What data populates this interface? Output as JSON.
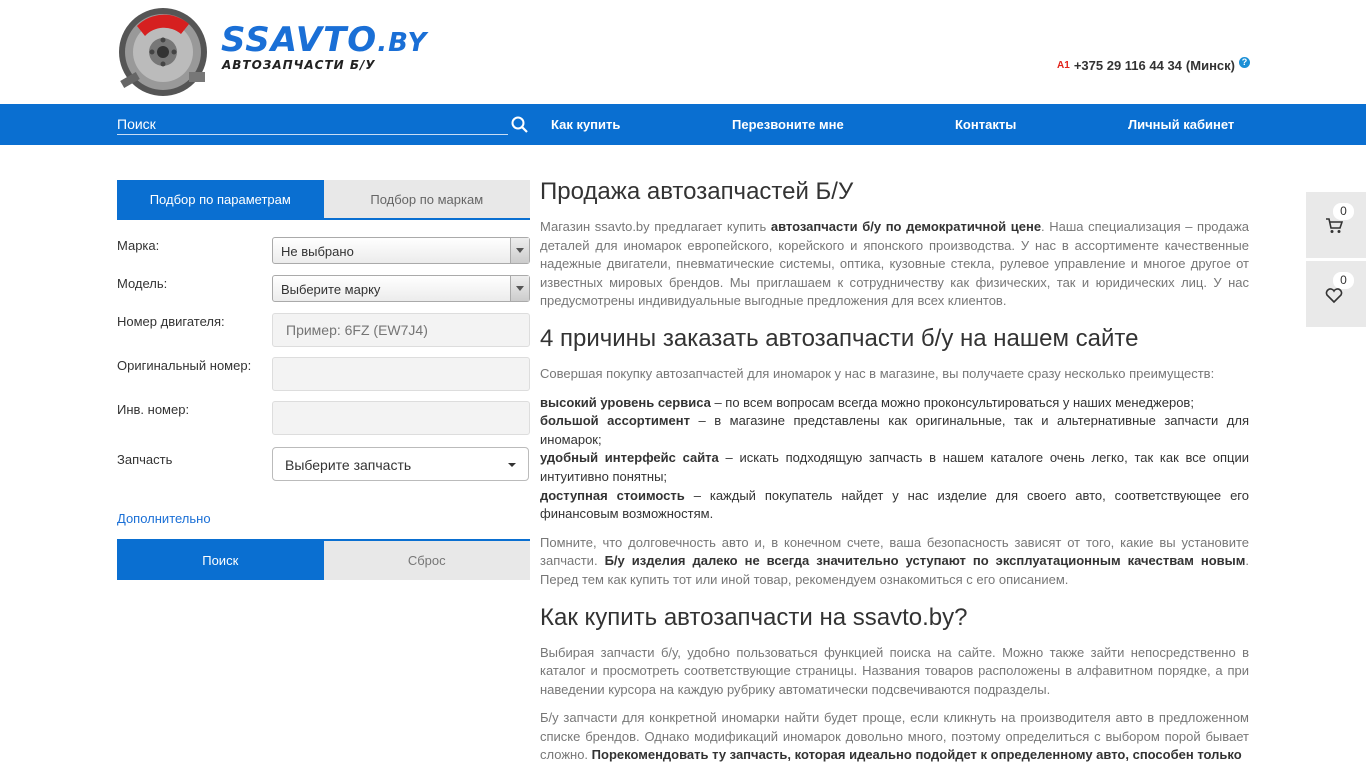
{
  "header": {
    "logo_main": "SSAVTO",
    "logo_domain": ".BY",
    "logo_sub": "АВТОЗАПЧАСТИ Б/У",
    "operator": "A1",
    "phone": "+375 29 116 44 34",
    "city": "(Минск)",
    "help": "?"
  },
  "nav": {
    "search_placeholder": "Поиск",
    "links": [
      "Как купить",
      "Перезвоните мне",
      "Контакты",
      "Личный кабинет"
    ]
  },
  "filter": {
    "tabs": [
      "Подбор по параметрам",
      "Подбор по маркам"
    ],
    "brand_label": "Марка:",
    "brand_value": "Не выбрано",
    "model_label": "Модель:",
    "model_value": "Выберите марку",
    "engine_label": "Номер двигателя:",
    "engine_placeholder": "Пример: 6FZ (EW7J4)",
    "original_label": "Оригинальный номер:",
    "inv_label": "Инв. номер:",
    "part_label": "Запчасть",
    "part_value": "Выберите запчасть",
    "extra": "Дополнительно",
    "search_btn": "Поиск",
    "reset_btn": "Сброс"
  },
  "content": {
    "h1": "Продажа автозапчастей Б/У",
    "p1_a": "Магазин ssavto.by предлагает купить ",
    "p1_b": "автозапчасти б/у по демократичной цене",
    "p1_c": ". Наша специализация – продажа деталей для иномарок европейского, корейского и японского производства. У нас в ассортименте качественные надежные двигатели, пневматические системы, оптика, кузовные стекла, рулевое управление и многое другое от известных мировых брендов. Мы приглашаем к сотрудничеству как физических, так и юридических лиц. У нас предусмотрены индивидуальные выгодные предложения для всех клиентов.",
    "h2_reasons": "4 причины заказать автозапчасти б/у на нашем сайте",
    "p2": "Совершая покупку автозапчастей для иномарок у нас в магазине, вы получаете сразу несколько преимуществ:",
    "reasons": [
      {
        "title": "высокий уровень сервиса",
        "text": " – по всем вопросам всегда можно проконсультироваться у наших менеджеров;"
      },
      {
        "title": "большой ассортимент",
        "text": " – в магазине представлены как оригинальные, так и альтернативные запчасти для иномарок;"
      },
      {
        "title": "удобный интерфейс сайта",
        "text": " – искать подходящую запчасть в нашем каталоге очень легко, так как все опции интуитивно понятны;"
      },
      {
        "title": "доступная стоимость",
        "text": " – каждый покупатель найдет у нас изделие для своего авто, соответствующее его финансовым возможностям."
      }
    ],
    "p3_a": "Помните, что долговечность авто и, в конечном счете, ваша безопасность зависят от того, какие вы установите запчасти. ",
    "p3_b": "Б/у изделия далеко не всегда значительно уступают по эксплуатационным качествам новым",
    "p3_c": ". Перед тем как купить тот или иной товар, рекомендуем ознакомиться с его описанием.",
    "h2_how": "Как купить автозапчасти на ssavto.by?",
    "p4": "Выбирая запчасти б/у, удобно пользоваться функцией поиска на сайте. Можно также зайти непосредственно в каталог и просмотреть соответствующие страницы. Названия товаров расположены в алфавитном порядке, а при наведении курсора на каждую рубрику автоматически подсвечиваются подразделы.",
    "p5_a": "Б/у запчасти для конкретной иномарки найти будет проще, если кликнуть на производителя авто в предложенном списке брендов. Однако модификаций иномарок довольно много, поэтому определиться с выбором порой бывает сложно. ",
    "p5_b": "Порекомендовать ту запчасть, которая идеально подойдет к определенному авто, способен только"
  },
  "widgets": {
    "cart_count": "0",
    "fav_count": "0"
  },
  "colors": {
    "primary": "#0a6fd1",
    "logo_blue": "#1a6fd6"
  }
}
